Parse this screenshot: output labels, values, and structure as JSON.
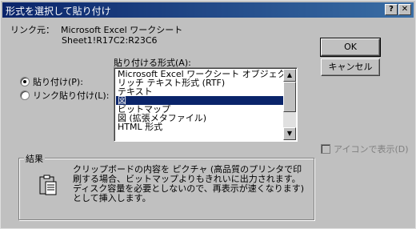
{
  "titlebar": {
    "title": "形式を選択して貼り付け",
    "help_label": "?",
    "close_label": "✕"
  },
  "source": {
    "label": "リンク元：",
    "name": "Microsoft Excel ワークシート",
    "range": "Sheet1!R17C2:R23C6"
  },
  "paste_as": {
    "label": "貼り付ける形式(A):",
    "items": [
      "Microsoft Excel ワークシート オブジェクト",
      "リッチ テキスト形式 (RTF)",
      "テキスト",
      "図",
      "ビットマップ",
      "図 (拡張メタファイル)",
      "HTML 形式"
    ],
    "selected_index": 3
  },
  "options": {
    "paste_label": "貼り付け(P):",
    "paste_link_label": "リンク貼り付け(L):",
    "selected": "paste"
  },
  "buttons": {
    "ok": "OK",
    "cancel": "キャンセル"
  },
  "display_as_icon": {
    "label": "アイコンで表示(D)",
    "checked": false,
    "enabled": false
  },
  "result": {
    "title": "結果",
    "text": "クリップボードの内容を ピクチャ (高品質のプリンタで印刷する場合、ビットマップよりもきれいに出力されます。ディスク容量を必要としないので、再表示が速くなります) として挿入します。"
  },
  "icons": {
    "scroll_up": "scroll-up-arrow-icon",
    "scroll_down": "scroll-down-arrow-icon",
    "result": "clipboard-paste-icon"
  },
  "colors": {
    "title_start": "#0a246a",
    "title_end": "#3a6ea5",
    "face": "#c0c0c0",
    "selection": "#0a246a"
  }
}
